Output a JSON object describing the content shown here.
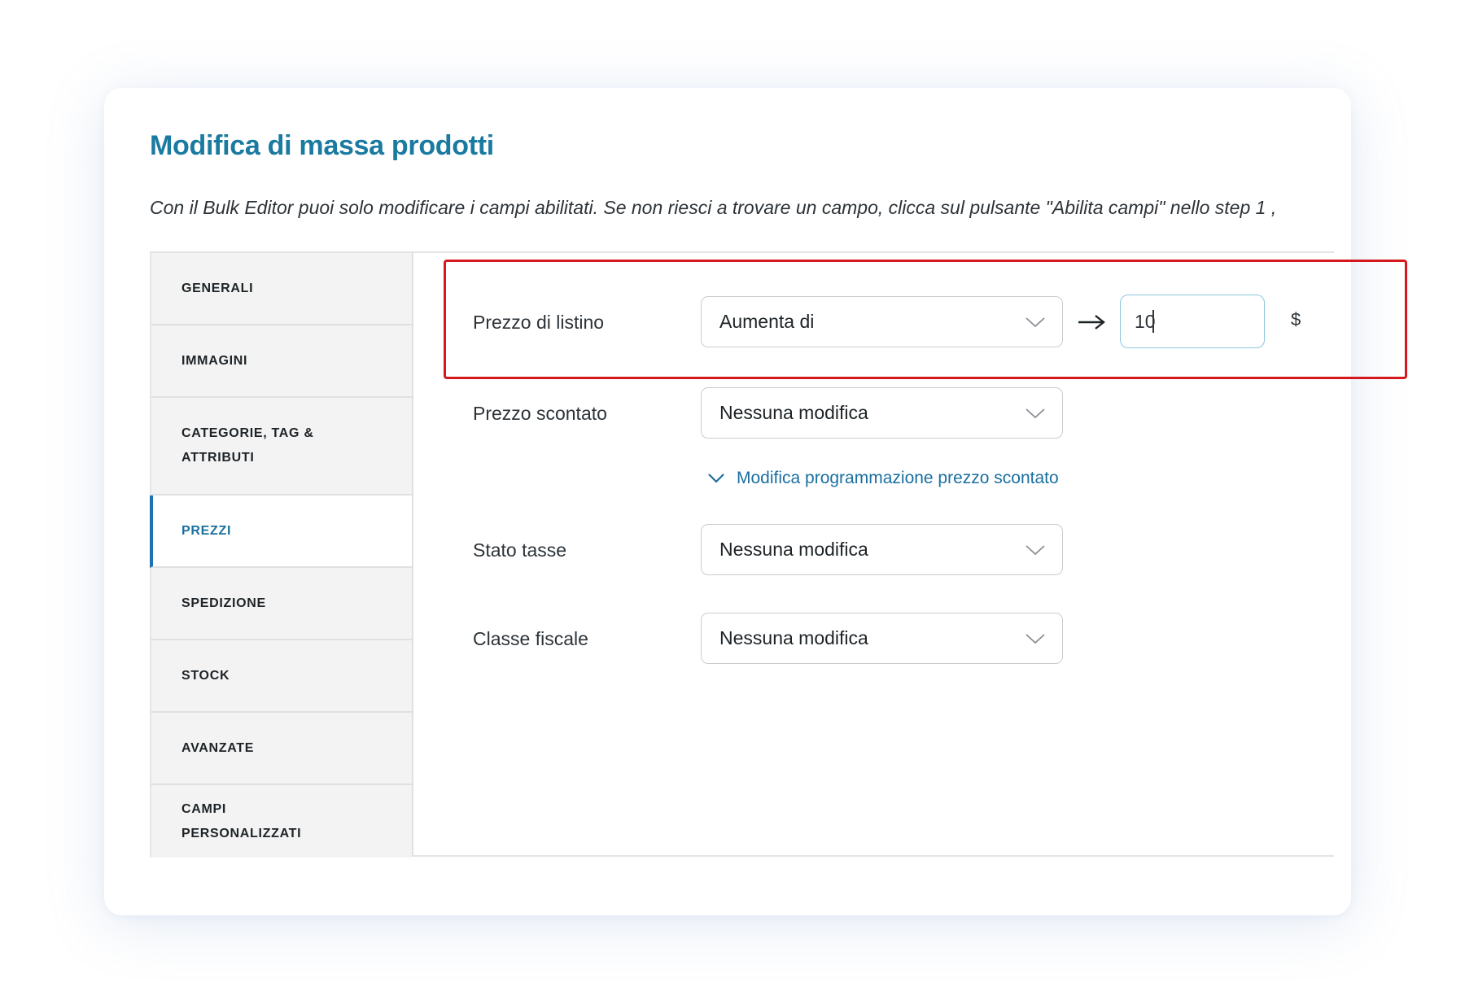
{
  "page": {
    "title": "Modifica di massa prodotti",
    "subtitle": "Con il Bulk Editor puoi solo modificare i campi abilitati. Se non riesci a trovare un campo, clicca sul pulsante \"Abilita campi\" nello step 1 ,"
  },
  "sidebar": {
    "items": [
      {
        "label": "GENERALI"
      },
      {
        "label": "IMMAGINI"
      },
      {
        "label": "CATEGORIE, TAG & ATTRIBUTI"
      },
      {
        "label": "PREZZI"
      },
      {
        "label": "SPEDIZIONE"
      },
      {
        "label": "STOCK"
      },
      {
        "label": "AVANZATE"
      },
      {
        "label": "CAMPI PERSONALIZZATI"
      }
    ],
    "active": "PREZZI"
  },
  "fields": {
    "list_price": {
      "label": "Prezzo di listino",
      "action": "Aumenta di",
      "value": "10",
      "currency": "$"
    },
    "sale_price": {
      "label": "Prezzo scontato",
      "action": "Nessuna modifica",
      "schedule_link": "Modifica programmazione prezzo scontato"
    },
    "tax_status": {
      "label": "Stato tasse",
      "action": "Nessuna modifica"
    },
    "tax_class": {
      "label": "Classe fiscale",
      "action": "Nessuna modifica"
    }
  },
  "icons": {
    "dropdown": "chevron-down-icon",
    "arrow": "arrow-right-icon",
    "link": "chevron-down-icon"
  },
  "colors": {
    "title": "#1a7aa0",
    "active_tab": "#1f72b0",
    "link": "#1a6fa0",
    "highlight": "#d4181c",
    "input_focus": "#8ec6de"
  }
}
